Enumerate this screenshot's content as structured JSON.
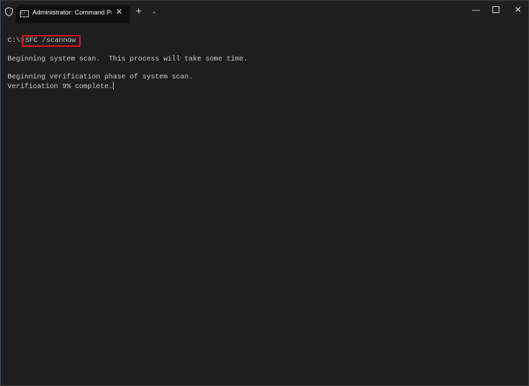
{
  "window": {
    "tab_title": "Administrator: Command Prompt",
    "icons": {
      "shield": "shield-icon",
      "tab": "cmd-icon",
      "close": "close-icon",
      "new_tab": "plus-icon",
      "dropdown": "chevron-down-icon",
      "minimize": "minimize-icon",
      "maximize": "maximize-icon",
      "window_close": "close-icon"
    }
  },
  "terminal": {
    "prompt": "C:\\>",
    "command": "SFC /scannow",
    "lines": [
      "Beginning system scan.  This process will take some time.",
      "",
      "Beginning verification phase of system scan.",
      "Verification 9% complete."
    ],
    "highlight_color": "#e81123"
  }
}
